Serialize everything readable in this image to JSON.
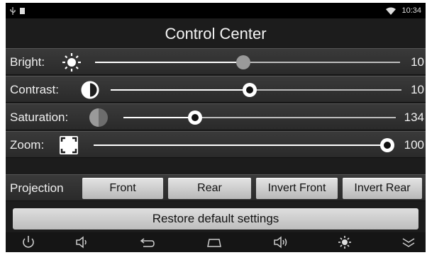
{
  "status_bar": {
    "time": "10:34",
    "icons": [
      "usb-icon",
      "notification-icon",
      "wifi-icon"
    ]
  },
  "title": "Control Center",
  "sliders": {
    "bright": {
      "label": "Bright:",
      "value": "10",
      "level": 0.485,
      "icon": "brightness-icon"
    },
    "contrast": {
      "label": "Contrast:",
      "value": "10",
      "level": 0.478,
      "icon": "contrast-icon"
    },
    "saturation": {
      "label": "Saturation:",
      "value": "134",
      "level": 0.262,
      "icon": "saturation-icon"
    },
    "zoom": {
      "label": "Zoom:",
      "value": "100",
      "level": 1.0,
      "icon": "zoom-icon"
    }
  },
  "projection": {
    "label": "Projection",
    "buttons": [
      "Front",
      "Rear",
      "Invert Front",
      "Invert Rear"
    ]
  },
  "restore_label": "Restore default settings",
  "nav_icons": [
    "power-icon",
    "volume-down-icon",
    "back-icon",
    "home-icon",
    "volume-up-icon",
    "brightness-icon",
    "expand-icon"
  ],
  "colors": {
    "background": "#1c1c1c",
    "row": "#333333",
    "button": "#cfcfcf"
  }
}
